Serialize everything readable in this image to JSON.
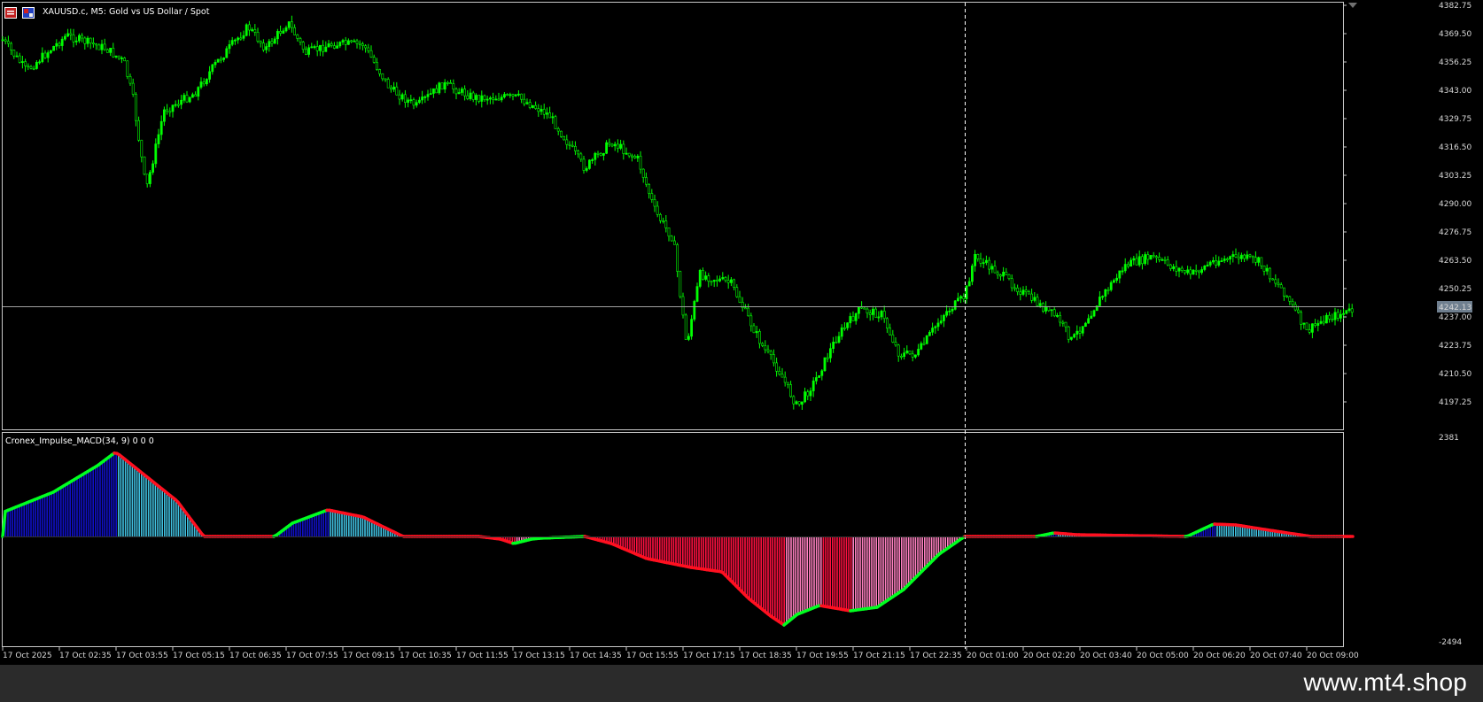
{
  "chart": {
    "title": "XAUUSD.c, M5:  Gold vs US Dollar / Spot",
    "current_price": "4242.13",
    "colors": {
      "background": "#000000",
      "candle": "#00ff00",
      "grid_line": "#a0a0a0",
      "crosshair": "#ffffff",
      "price_tag_bg": "#6f7f8f"
    },
    "price_axis": [
      "4382.75",
      "4369.50",
      "4356.25",
      "4343.00",
      "4329.75",
      "4316.50",
      "4303.25",
      "4290.00",
      "4276.75",
      "4263.50",
      "4250.25",
      "4237.00",
      "4223.75",
      "4210.50",
      "4197.25"
    ],
    "time_axis": [
      "17 Oct 2025",
      "17 Oct 02:35",
      "17 Oct 03:55",
      "17 Oct 05:15",
      "17 Oct 06:35",
      "17 Oct 07:55",
      "17 Oct 09:15",
      "17 Oct 10:35",
      "17 Oct 11:55",
      "17 Oct 13:15",
      "17 Oct 14:35",
      "17 Oct 15:55",
      "17 Oct 17:15",
      "17 Oct 18:35",
      "17 Oct 19:55",
      "17 Oct 21:15",
      "17 Oct 22:35",
      "20 Oct 01:00",
      "20 Oct 02:20",
      "20 Oct 03:40",
      "20 Oct 05:00",
      "20 Oct 06:20",
      "20 Oct 07:40",
      "20 Oct 09:00"
    ]
  },
  "indicator": {
    "name": "Cronex_Impulse_MACD(34, 9) 0 0 0",
    "axis_top": "2381",
    "axis_bottom": "-2494",
    "colors": {
      "up_strong": "#1010c8",
      "up_weak": "#40c0e0",
      "down_strong": "#ff1040",
      "down_weak": "#ff80c0",
      "signal_up": "#00ff20",
      "signal_down": "#ff1020"
    }
  },
  "toolbar": {
    "chart_icon": "chart-window-icon",
    "symbol_icon": "currency-flag-icon"
  },
  "watermark": "www.mt4.shop"
}
